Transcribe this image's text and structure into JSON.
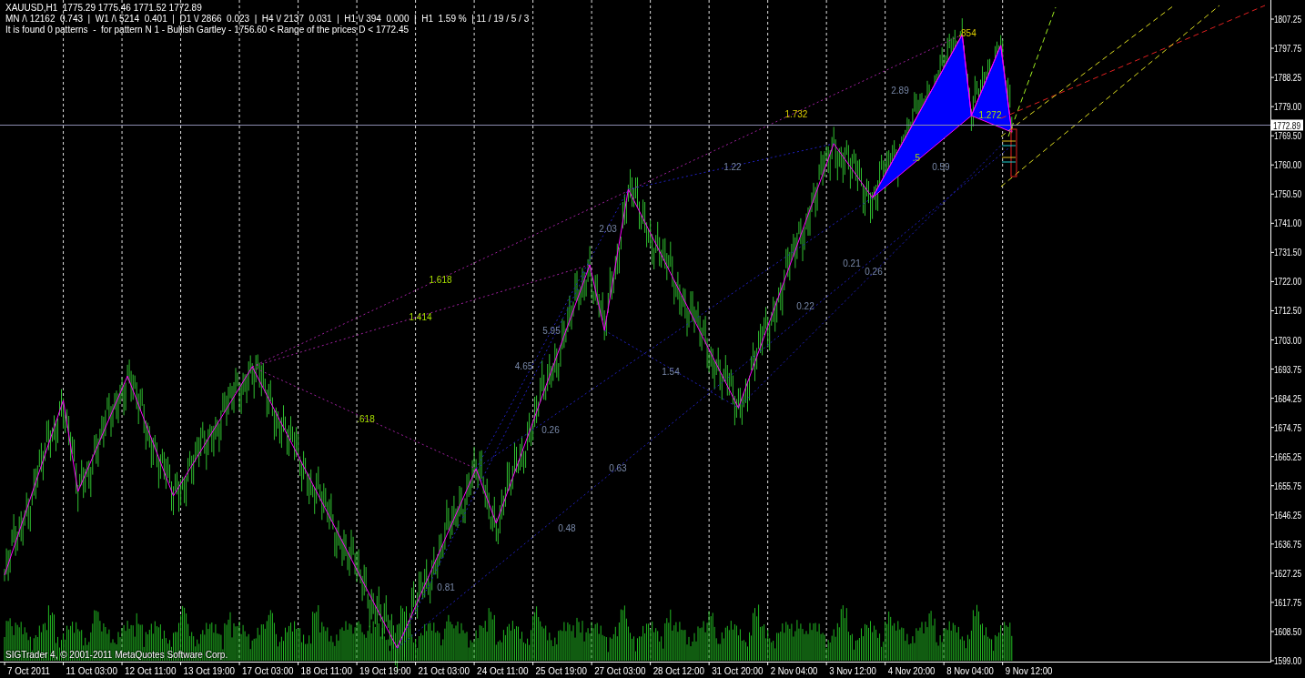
{
  "header": {
    "quote": "XAUUSD,H1  1775.29 1775.46 1771.52 1772.89",
    "stats": "MN /\\ 12162  0.743  |  W1 /\\ 5214  0.401  |  D1 \\/ 2866  0.023  |  H4 \\/ 2137  0.031  |  H1 \\/ 394  0.000  |  H1  1.59 %  | 11 / 19 / 5 / 3",
    "message": "It is found 0 patterns  -  for pattern N 1 - Bullish Gartley - 1756.60 < Range of the prices D < 1772.45"
  },
  "chart": {
    "copyright": "SIGTrader 4, © 2001-2011 MetaQuotes Software Corp.",
    "current_price": "1772.89",
    "time_axis": [
      "7 Oct 2011",
      "11 Oct 03:00",
      "12 Oct 11:00",
      "13 Oct 19:00",
      "17 Oct 03:00",
      "18 Oct 11:00",
      "19 Oct 19:00",
      "21 Oct 03:00",
      "24 Oct 11:00",
      "25 Oct 19:00",
      "27 Oct 03:00",
      "28 Oct 12:00",
      "31 Oct 20:00",
      "2 Nov 04:00",
      "3 Nov 12:00",
      "4 Nov 20:00",
      "8 Nov 04:00",
      "9 Nov 12:00"
    ],
    "price_axis": [
      "1807.25",
      "1797.75",
      "1788.25",
      "1779.00",
      "1769.50",
      "1760.00",
      "1750.50",
      "1741.00",
      "1731.50",
      "1722.00",
      "1712.50",
      "1703.00",
      "1693.75",
      "1684.25",
      "1674.75",
      "1665.25",
      "1655.75",
      "1646.25",
      "1636.75",
      "1627.25",
      "1617.75",
      "1608.50",
      "1599.00"
    ],
    "ratio_labels": [
      "1.618",
      "1.414",
      ".618",
      "1.732",
      ".854",
      "1.272",
      ".5",
      "2.89",
      "1.22",
      "2.03",
      "5.95",
      "4.65",
      "0.26",
      "0.63",
      "0.48",
      "0.81",
      "1.54",
      "0.22",
      "0.21",
      "0.26",
      "0.59"
    ]
  }
}
